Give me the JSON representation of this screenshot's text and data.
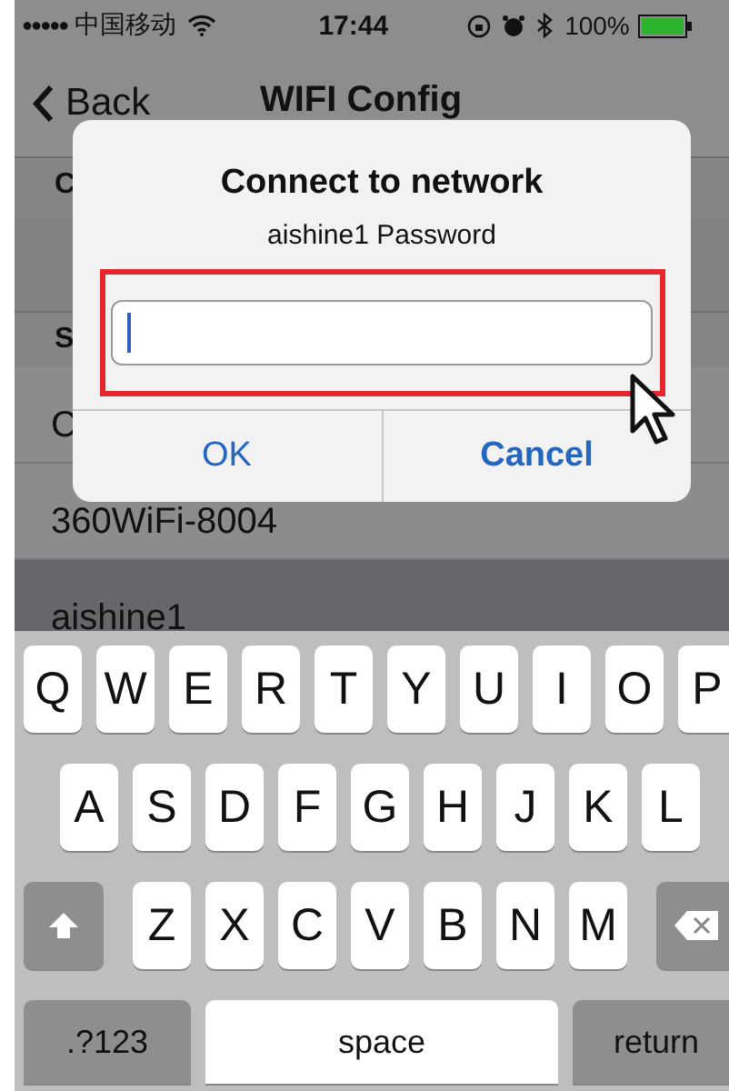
{
  "status_bar": {
    "signal": "●●●●●",
    "carrier": "中国移动",
    "time": "17:44",
    "battery": "100%"
  },
  "nav": {
    "back": "Back",
    "title": "WIFI Config"
  },
  "current_header": "C",
  "select_header": "S",
  "networks": [
    {
      "name": "C",
      "selected": false
    },
    {
      "name": "360WiFi-8004",
      "selected": false
    },
    {
      "name": "aishine1",
      "selected": true
    }
  ],
  "dialog": {
    "title": "Connect to network",
    "message": "aishine1 Password",
    "field": {
      "focused": true,
      "highlighted": true
    },
    "buttons": [
      "OK",
      "Cancel"
    ]
  },
  "keyboard": {
    "rows": [
      [
        {
          "kind": "letter",
          "label": "Q"
        },
        {
          "kind": "letter",
          "label": "W"
        },
        {
          "kind": "letter",
          "label": "E"
        },
        {
          "kind": "letter",
          "label": "R"
        },
        {
          "kind": "letter",
          "label": "T"
        },
        {
          "kind": "letter",
          "label": "Y"
        },
        {
          "kind": "letter",
          "label": "U"
        },
        {
          "kind": "letter",
          "label": "I"
        },
        {
          "kind": "letter",
          "label": "O"
        },
        {
          "kind": "letter",
          "label": "P"
        }
      ],
      [
        {
          "kind": "letter",
          "label": "A"
        },
        {
          "kind": "letter",
          "label": "S"
        },
        {
          "kind": "letter",
          "label": "D"
        },
        {
          "kind": "letter",
          "label": "F"
        },
        {
          "kind": "letter",
          "label": "G"
        },
        {
          "kind": "letter",
          "label": "H"
        },
        {
          "kind": "letter",
          "label": "J"
        },
        {
          "kind": "letter",
          "label": "K"
        },
        {
          "kind": "letter",
          "label": "L"
        }
      ],
      [
        {
          "kind": "shift"
        },
        {
          "kind": "letter",
          "label": "Z"
        },
        {
          "kind": "letter",
          "label": "X"
        },
        {
          "kind": "letter",
          "label": "C"
        },
        {
          "kind": "letter",
          "label": "V"
        },
        {
          "kind": "letter",
          "label": "B"
        },
        {
          "kind": "letter",
          "label": "N"
        },
        {
          "kind": "letter",
          "label": "M"
        },
        {
          "kind": "delete"
        }
      ]
    ],
    "bottom_keys": [
      {
        "kind": "mode",
        "label": ".?123"
      },
      {
        "kind": "space",
        "label": "space"
      },
      {
        "kind": "return",
        "label": "return"
      }
    ]
  }
}
